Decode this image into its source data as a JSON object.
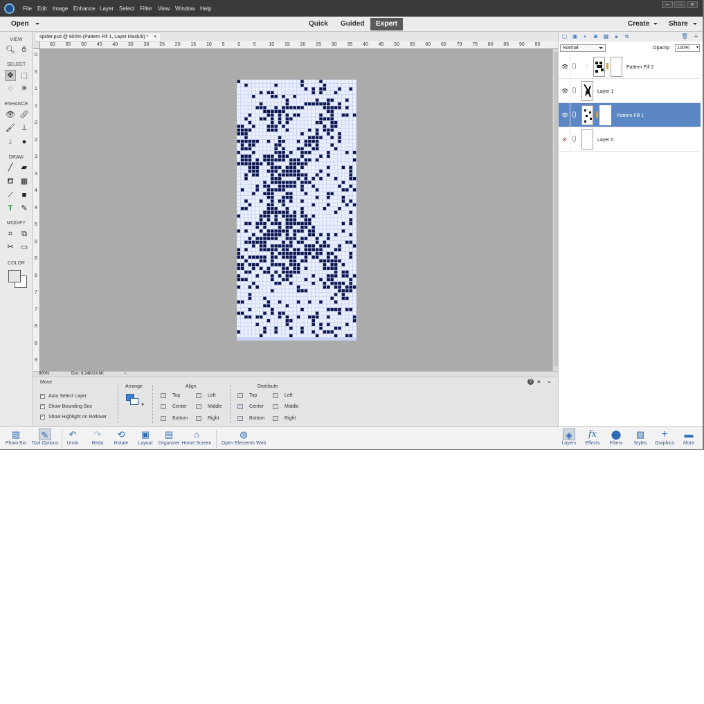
{
  "menubar": {
    "items": [
      "File",
      "Edit",
      "Image",
      "Enhance",
      "Layer",
      "Select",
      "Filter",
      "View",
      "Window",
      "Help"
    ]
  },
  "modebar": {
    "open_label": "Open",
    "modes": [
      "Quick",
      "Guided",
      "Expert"
    ],
    "active_mode": "Expert",
    "create_label": "Create",
    "share_label": "Share"
  },
  "toolbox": {
    "sections": {
      "view": "VIEW",
      "select": "SELECT",
      "enhance": "ENHANCE",
      "draw": "DRAW",
      "modify": "MODIFY",
      "color": "COLOR"
    }
  },
  "document": {
    "tab_title": "spider.psd @ 800% (Pattern Fill 1, Layer Mask/8) *",
    "close_glyph": "×",
    "ruler_h": [
      "60",
      "55",
      "50",
      "45",
      "40",
      "35",
      "30",
      "25",
      "20",
      "15",
      "10",
      "5",
      "0",
      "5",
      "10",
      "15",
      "20",
      "25",
      "30",
      "35",
      "40",
      "45",
      "50",
      "55",
      "60",
      "65",
      "70",
      "75",
      "80",
      "85",
      "90",
      "95"
    ],
    "ruler_v": [
      "0",
      "5",
      "1",
      "1",
      "2",
      "2",
      "3",
      "3",
      "4",
      "4",
      "5",
      "5",
      "6",
      "6",
      "7",
      "7",
      "8",
      "8",
      "9"
    ],
    "zoom": "800%",
    "doc_size": "Doc: 9.24K/24.6K",
    "pattern_color": "#0a1449",
    "pattern_light": "#eef2ff"
  },
  "tool_options": {
    "move_title": "Move",
    "checkboxes": [
      {
        "label": "Auto Select Layer",
        "checked": true
      },
      {
        "label": "Show Bounding Box",
        "checked": true
      },
      {
        "label": "Show Highlight on Rollover",
        "checked": true
      }
    ],
    "arrange_title": "Arrange",
    "align_title": "Align",
    "align": {
      "top": "Top",
      "center": "Center",
      "bottom": "Bottom",
      "left": "Left",
      "middle": "Middle",
      "right": "Right"
    },
    "distribute_title": "Distribute",
    "distribute": {
      "top": "Top",
      "center": "Center",
      "bottom": "Bottom",
      "left": "Left",
      "middle": "Middle",
      "right": "Right"
    },
    "help_glyph": "?"
  },
  "bottombar": {
    "left": [
      {
        "label": "Photo Bin",
        "icon": "photo-bin-icon"
      },
      {
        "label": "Tool Options",
        "icon": "tool-options-icon"
      },
      {
        "label": "Undo",
        "icon": "undo-icon"
      },
      {
        "label": "Redo",
        "icon": "redo-icon"
      },
      {
        "label": "Rotate",
        "icon": "rotate-icon"
      },
      {
        "label": "Layout",
        "icon": "layout-icon"
      },
      {
        "label": "Organizer",
        "icon": "organizer-icon"
      },
      {
        "label": "Home Screen",
        "icon": "home-icon"
      },
      {
        "label": "Open Elements Web",
        "icon": "globe-icon"
      }
    ],
    "right": [
      {
        "label": "Layers",
        "icon": "layers-icon"
      },
      {
        "label": "Effects",
        "icon": "effects-icon"
      },
      {
        "label": "Filters",
        "icon": "filters-icon"
      },
      {
        "label": "Styles",
        "icon": "styles-icon"
      },
      {
        "label": "Graphics",
        "icon": "graphics-icon"
      },
      {
        "label": "More",
        "icon": "more-icon"
      }
    ]
  },
  "layers_panel": {
    "blend_mode": "Normal",
    "opacity_label": "Opacity:",
    "opacity_value": "100%",
    "layers": [
      {
        "name": "Pattern Fill 2",
        "visible": true,
        "selected": false
      },
      {
        "name": "Layer 1",
        "visible": true,
        "selected": false
      },
      {
        "name": "Pattern Fill 1",
        "visible": true,
        "selected": true
      },
      {
        "name": "Layer 0",
        "visible": false,
        "selected": false
      }
    ]
  },
  "colors": {
    "accent": "#5b87c5",
    "menubar_bg": "#3a3a3a",
    "canvas_bg": "#ababab"
  }
}
